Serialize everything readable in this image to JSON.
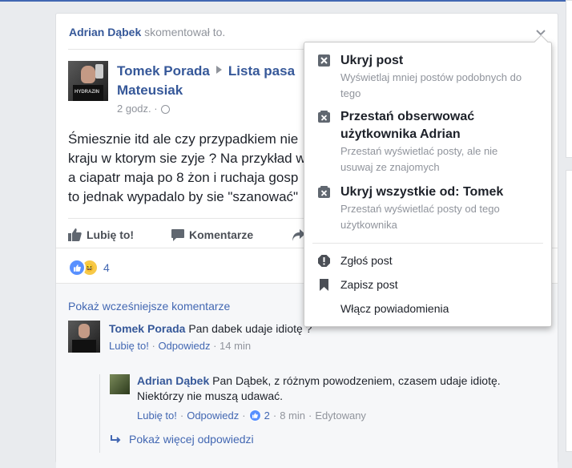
{
  "story": {
    "actor": "Adrian Dąbek",
    "action": "skomentował to."
  },
  "post": {
    "author": "Tomek Porada",
    "target_group_part1": "Lista pasa",
    "target_group_part2": "Mateusiak",
    "time": "2 godz. ·",
    "text_lines": [
      "Śmiesznie itd ale czy przypadkiem nie",
      "kraju w ktorym sie zyje ? Na przykład w",
      "a ciapatr maja po 8 żon i ruchaja gosp",
      "to jednak wypadalo by sie \"szanować\""
    ]
  },
  "actions": {
    "like": "Lubię to!",
    "comment": "Komentarze"
  },
  "reactions": {
    "count": "4"
  },
  "comments": {
    "show_previous": "Pokaż wcześniejsze komentarze",
    "items": [
      {
        "author": "Tomek Porada",
        "text": "Pan dabek udaje idiotę ?",
        "like": "Lubię to!",
        "reply": "Odpowiedz",
        "time": "14 min"
      }
    ],
    "reply": {
      "author": "Adrian Dąbek",
      "text_line1": "Pan Dąbek, z różnym powodzeniem, czasem udaje idiotę.",
      "text_line2": "Niektórzy nie muszą udawać.",
      "like": "Lubię to!",
      "reply": "Odpowiedz",
      "reaction_count": "2",
      "time": "8 min",
      "edited": "Edytowany"
    },
    "show_more_replies": "Pokaż więcej odpowiedzi"
  },
  "menu": {
    "items": [
      {
        "title": "Ukryj post",
        "desc_line1": "Wyświetlaj mniej postów podobnych do",
        "desc_line2": "tego"
      },
      {
        "title_line1": "Przestań obserwować",
        "title_line2": "użytkownika Adrian",
        "desc_line1": "Przestań wyświetlać posty, ale nie",
        "desc_line2": "usuwaj ze znajomych"
      },
      {
        "title": "Ukryj wszystkie od: Tomek",
        "desc_line1": "Przestań wyświetlać posty od tego",
        "desc_line2": "użytkownika"
      }
    ],
    "report": "Zgłoś post",
    "save": "Zapisz post",
    "notifications": "Włącz powiadomienia"
  },
  "colors": {
    "link": "#365899",
    "accent": "#4267b2",
    "meta": "#90949c",
    "background": "#e9ebee"
  }
}
